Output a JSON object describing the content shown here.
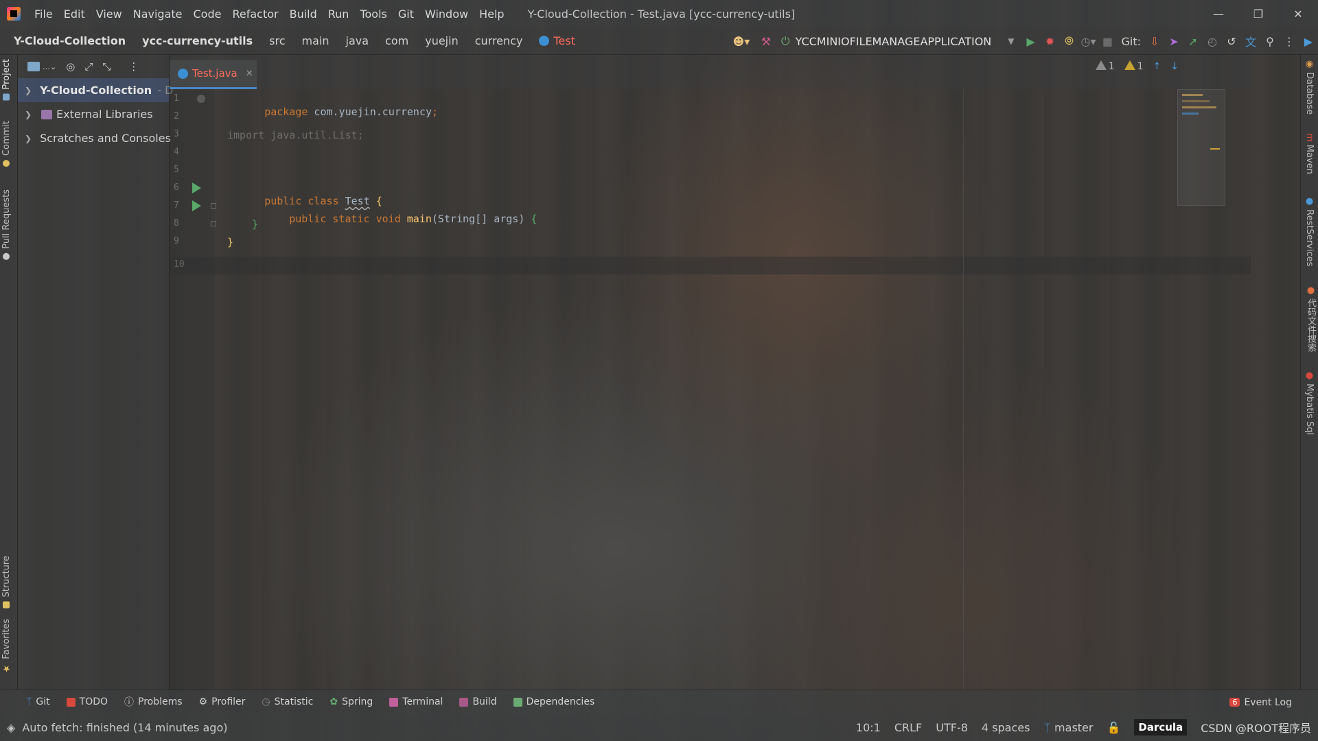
{
  "menubar": {
    "items": [
      "File",
      "Edit",
      "View",
      "Navigate",
      "Code",
      "Refactor",
      "Build",
      "Run",
      "Tools",
      "Git",
      "Window",
      "Help"
    ],
    "window_title": "Y-Cloud-Collection - Test.java [ycc-currency-utils]"
  },
  "navbar": {
    "breadcrumbs": [
      "Y-Cloud-Collection",
      "ycc-currency-utils",
      "src",
      "main",
      "java",
      "com",
      "yuejin",
      "currency"
    ],
    "current_class": "Test",
    "run_config": "YCCMINIOFILEMANAGEAPPLICATION",
    "git_label": "Git:"
  },
  "left_strip": {
    "project": "Project",
    "commit": "Commit",
    "pull_requests": "Pull Requests",
    "structure": "Structure",
    "favorites": "Favorites"
  },
  "project_tree": {
    "rows": [
      {
        "label": "Y-Cloud-Collection",
        "suffix": "- D",
        "selected": true,
        "icon_color": "#7ea7c9"
      },
      {
        "label": "External Libraries",
        "suffix": "",
        "selected": false,
        "icon_color": "#9876aa"
      },
      {
        "label": "Scratches and Consoles",
        "suffix": "",
        "selected": false,
        "icon_color": "#c0664a"
      }
    ]
  },
  "editor": {
    "tab_name": "Test.java",
    "line_numbers": [
      "1",
      "2",
      "3",
      "4",
      "5",
      "6",
      "7",
      "8",
      "9",
      "10"
    ],
    "code": {
      "l1_kw": "package",
      "l1_pkg": " com.yuejin.currency",
      "l1_semi": ";",
      "l3": "import java.util.List;",
      "l5_kw": "public class ",
      "l5_cls": "Test",
      "l5_brace": " {",
      "l6_kw": "public static void ",
      "l6_fn": "main",
      "l6_args": "(String[] args) ",
      "l6_brace": "{",
      "l7": "}",
      "l9": "}"
    },
    "inspections": {
      "weak_warnings": "1",
      "warnings": "1"
    }
  },
  "right_strip": {
    "database": "Database",
    "maven": "Maven",
    "rest_services": "RestServices",
    "translate": "代码文件搜索",
    "mybatis": "Mybatis Sql"
  },
  "tool_windows": [
    {
      "label": "Git",
      "color": "#4a88c7"
    },
    {
      "label": "TODO",
      "color": "#d9483c"
    },
    {
      "label": "Problems",
      "color": "#c8c8c8"
    },
    {
      "label": "Profiler",
      "color": "#c8c8c8"
    },
    {
      "label": "Statistic",
      "color": "#8c8c8c"
    },
    {
      "label": "Spring",
      "color": "#6aab73"
    },
    {
      "label": "Terminal",
      "color": "#c0609a"
    },
    {
      "label": "Build",
      "color": "#c0609a"
    },
    {
      "label": "Dependencies",
      "color": "#6aab73"
    }
  ],
  "event_log": {
    "count": "6",
    "label": "Event Log"
  },
  "status": {
    "message": "Auto fetch: finished (14 minutes ago)",
    "position": "10:1",
    "line_sep": "CRLF",
    "encoding": "UTF-8",
    "indent": "4 spaces",
    "branch": "master",
    "theme": "Darcula",
    "watermark": "CSDN @ROOT程序员"
  },
  "colors": {
    "keyword": "#cc7832",
    "function": "#ffc66d",
    "text": "#a9b7c6",
    "error_tab": "#ff6b5b",
    "run_green": "#59a869"
  }
}
